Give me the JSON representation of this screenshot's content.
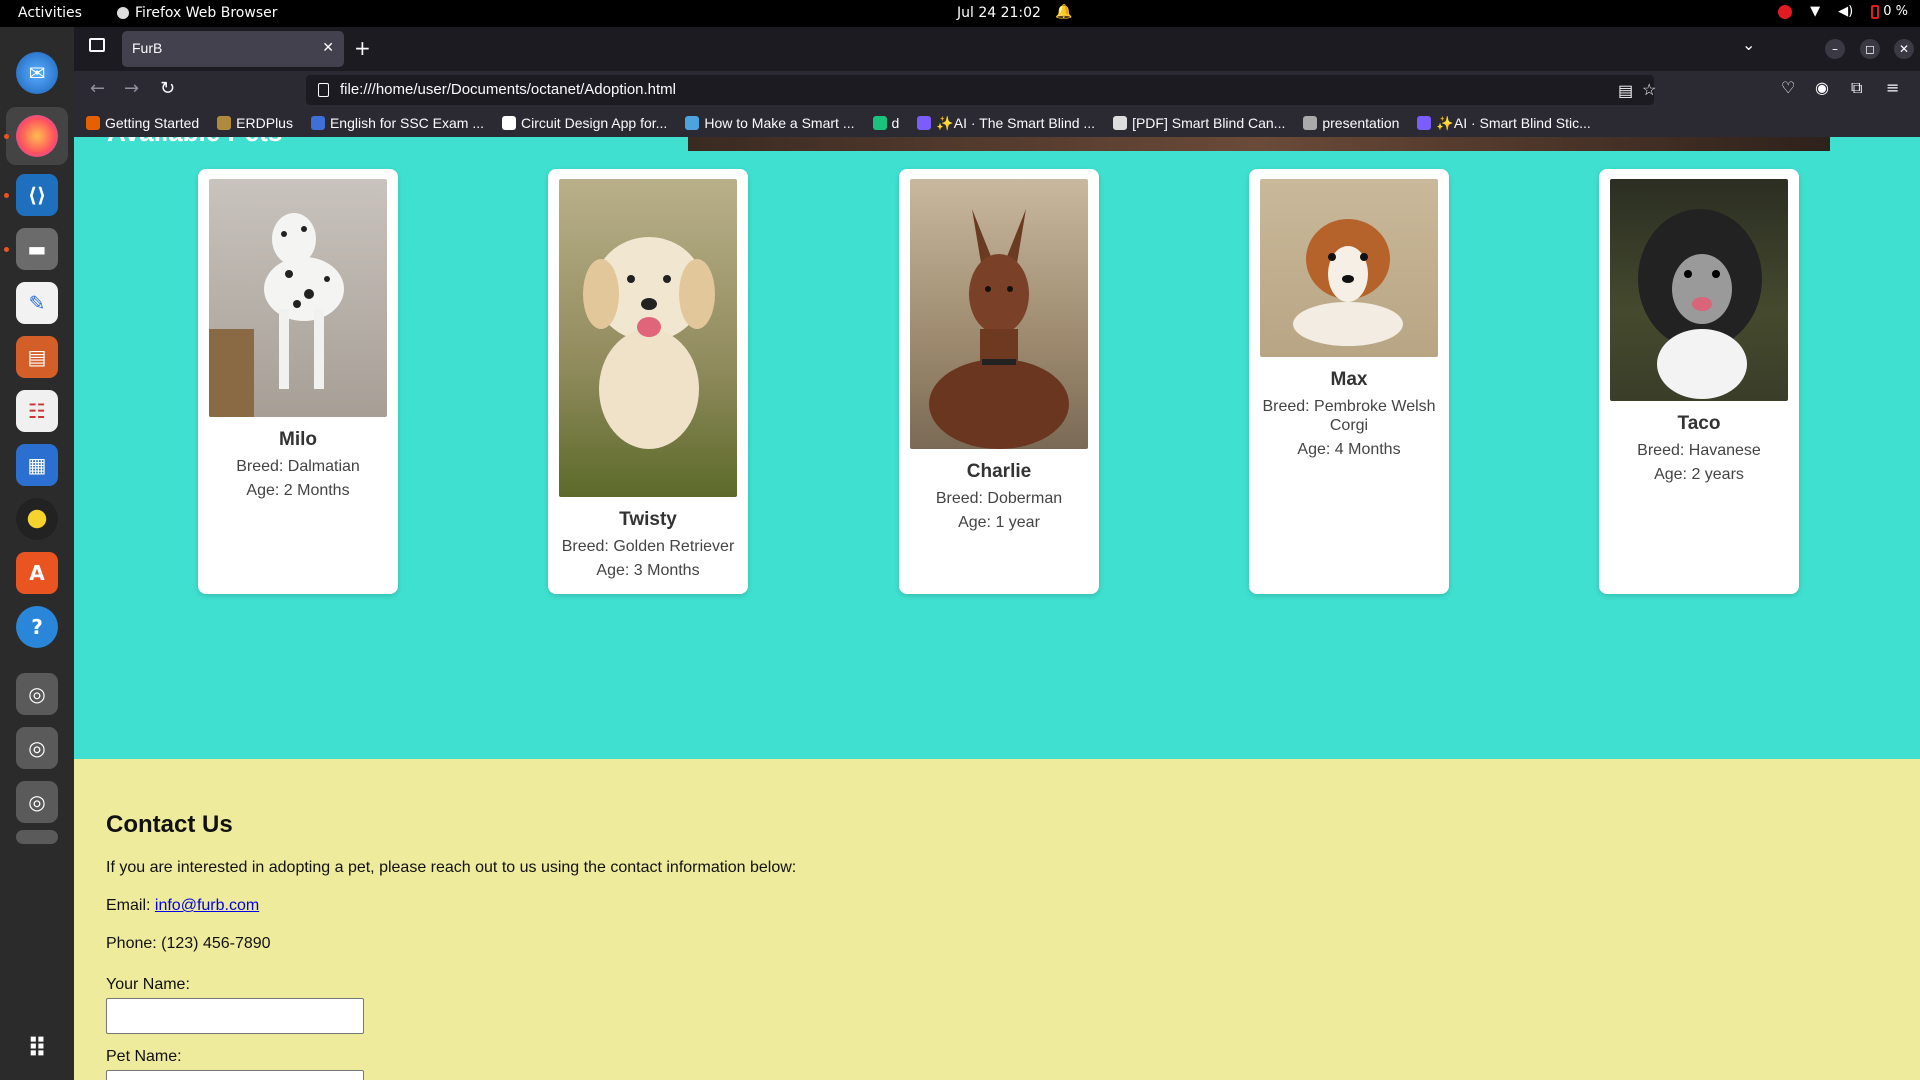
{
  "system": {
    "activities": "Activities",
    "app_name": "Firefox Web Browser",
    "clock": "Jul 24  21:02",
    "battery": "0 %"
  },
  "browser": {
    "tab_title": "FurB",
    "url": "file:///home/user/Documents/octanet/Adoption.html",
    "bookmarks": [
      {
        "label": "Getting Started",
        "color": "#e66000"
      },
      {
        "label": "ERDPlus",
        "color": "#b08a3c"
      },
      {
        "label": "English for SSC Exam ...",
        "color": "#3f6fd8"
      },
      {
        "label": "Circuit Design App for...",
        "color": "#ffffff"
      },
      {
        "label": "How to Make a Smart ...",
        "color": "#4ca3dd"
      },
      {
        "label": "d",
        "color": "#19c37d"
      },
      {
        "label": "✨AI · The Smart Blind ...",
        "color": "#7b5cff"
      },
      {
        "label": "[PDF] Smart Blind Can...",
        "color": "#dddddd"
      },
      {
        "label": "presentation",
        "color": "#aaaaaa"
      },
      {
        "label": "✨AI · Smart Blind Stic...",
        "color": "#7b5cff"
      }
    ]
  },
  "page": {
    "pets_heading": "Available Pets",
    "pets": [
      {
        "name": "Milo",
        "breed": "Breed: Dalmatian",
        "age": "Age: 2 Months"
      },
      {
        "name": "Twisty",
        "breed": "Breed: Golden Retriever",
        "age": "Age: 3 Months"
      },
      {
        "name": "Charlie",
        "breed": "Breed: Doberman",
        "age": "Age: 1 year"
      },
      {
        "name": "Max",
        "breed": "Breed: Pembroke Welsh Corgi",
        "age": "Age: 4 Months"
      },
      {
        "name": "Taco",
        "breed": "Breed: Havanese",
        "age": "Age: 2 years"
      }
    ],
    "contact": {
      "title": "Contact Us",
      "intro": "If you are interested in adopting a pet, please reach out to us using the contact information below:",
      "email_label": "Email:",
      "email": "info@furb.com",
      "phone": "Phone: (123) 456-7890",
      "name_label": "Your Name:",
      "pet_label": "Pet Name:"
    }
  },
  "colors": {
    "pets_bg": "#40e0d0",
    "contact_bg": "#eeeb9c",
    "link": "#0000ee"
  }
}
